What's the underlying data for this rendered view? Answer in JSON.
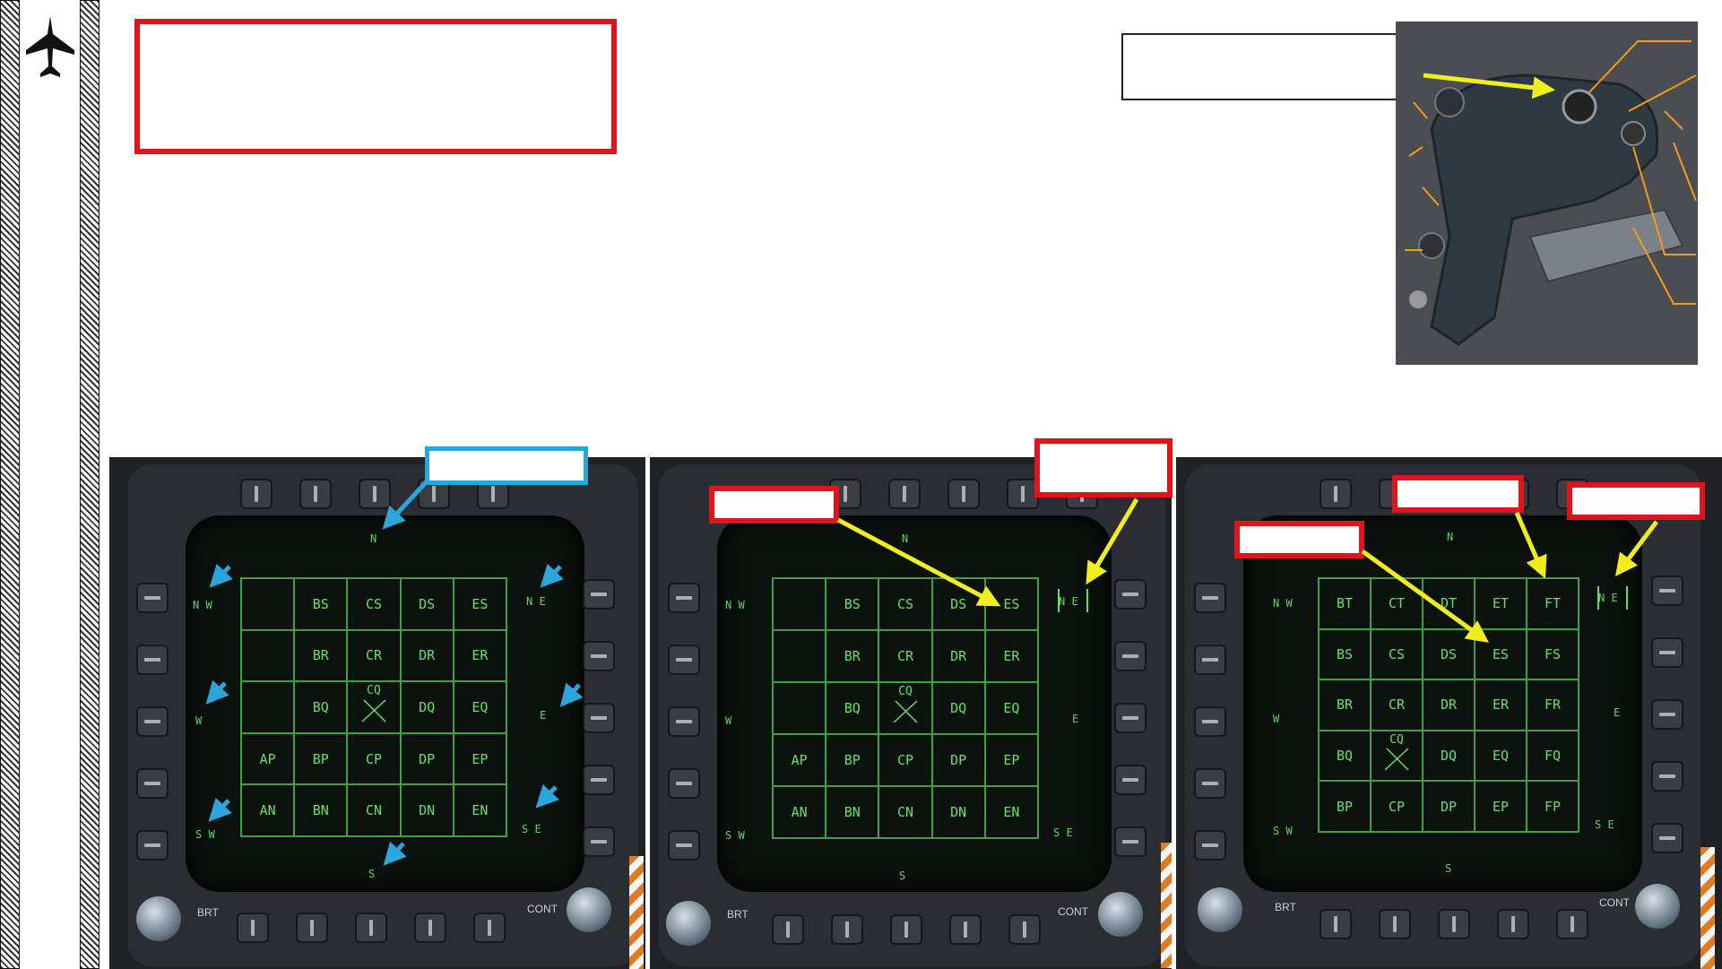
{
  "sidebar": {
    "logo_icon": "fighter-jet-icon"
  },
  "colors": {
    "red": "#e0141b",
    "blue": "#2aa6dc",
    "yellow": "#f2ee1c",
    "orange": "#f39a1e",
    "green": "#66e066"
  },
  "mfd": {
    "bottom_left_label": "BRT",
    "bottom_right_label": "CONT"
  },
  "panel1": {
    "compass": {
      "n": "N",
      "nw": "N W",
      "ne": "N E",
      "w": "W",
      "e": "E",
      "sw": "S W",
      "se": "S E",
      "s": "S"
    },
    "grid_cursor": "CQ",
    "grid": [
      [
        "",
        "BS",
        "CS",
        "DS",
        "ES"
      ],
      [
        "",
        "BR",
        "CR",
        "DR",
        "ER"
      ],
      [
        "",
        "BQ",
        "",
        "DQ",
        "EQ"
      ],
      [
        "AP",
        "BP",
        "CP",
        "DP",
        "EP"
      ],
      [
        "AN",
        "BN",
        "CN",
        "DN",
        "EN"
      ]
    ]
  },
  "panel2": {
    "compass": {
      "n": "N",
      "nw": "N W",
      "ne": "N E",
      "w": "W",
      "e": "E",
      "sw": "S W",
      "se": "S E",
      "s": "S"
    },
    "grid_cursor": "CQ",
    "grid": [
      [
        "",
        "BS",
        "CS",
        "DS",
        "ES"
      ],
      [
        "",
        "BR",
        "CR",
        "DR",
        "ER"
      ],
      [
        "",
        "BQ",
        "",
        "DQ",
        "EQ"
      ],
      [
        "AP",
        "BP",
        "CP",
        "DP",
        "EP"
      ],
      [
        "AN",
        "BN",
        "CN",
        "DN",
        "EN"
      ]
    ]
  },
  "panel3": {
    "compass": {
      "n": "N",
      "nw": "N W",
      "ne": "N E",
      "w": "W",
      "e": "E",
      "sw": "S W",
      "se": "S E",
      "s": "S"
    },
    "grid_cursor": "CQ",
    "grid": [
      [
        "BT",
        "CT",
        "DT",
        "ET",
        "FT"
      ],
      [
        "BS",
        "CS",
        "DS",
        "ES",
        "FS"
      ],
      [
        "BR",
        "CR",
        "DR",
        "ER",
        "FR"
      ],
      [
        "BQ",
        "",
        "DQ",
        "EQ",
        "FQ"
      ],
      [
        "BP",
        "CP",
        "DP",
        "EP",
        "FP"
      ]
    ]
  }
}
